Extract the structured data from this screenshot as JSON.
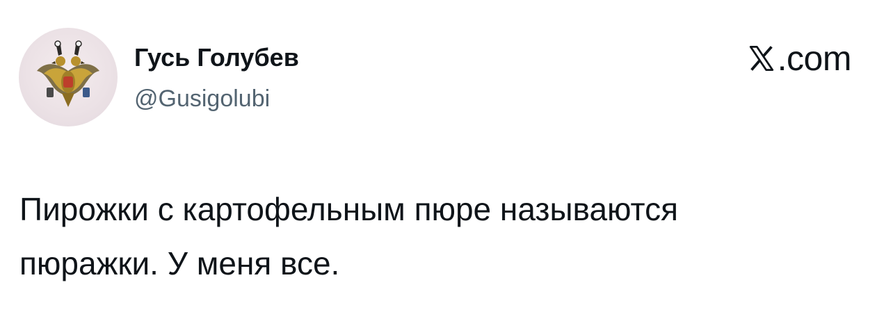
{
  "author": {
    "display_name": "Гусь Голубев",
    "handle": "@Gusigolubi",
    "avatar_icon": "double-headed-eagle-emblem-icon"
  },
  "brand": {
    "icon": "x-logo-icon",
    "text": ".com"
  },
  "tweet": {
    "lines": [
      "Пирожки с картофельным пюре называются",
      "пюражки. У меня все."
    ]
  },
  "colors": {
    "text": "#0f1419",
    "secondary": "#536471",
    "background": "#ffffff"
  }
}
